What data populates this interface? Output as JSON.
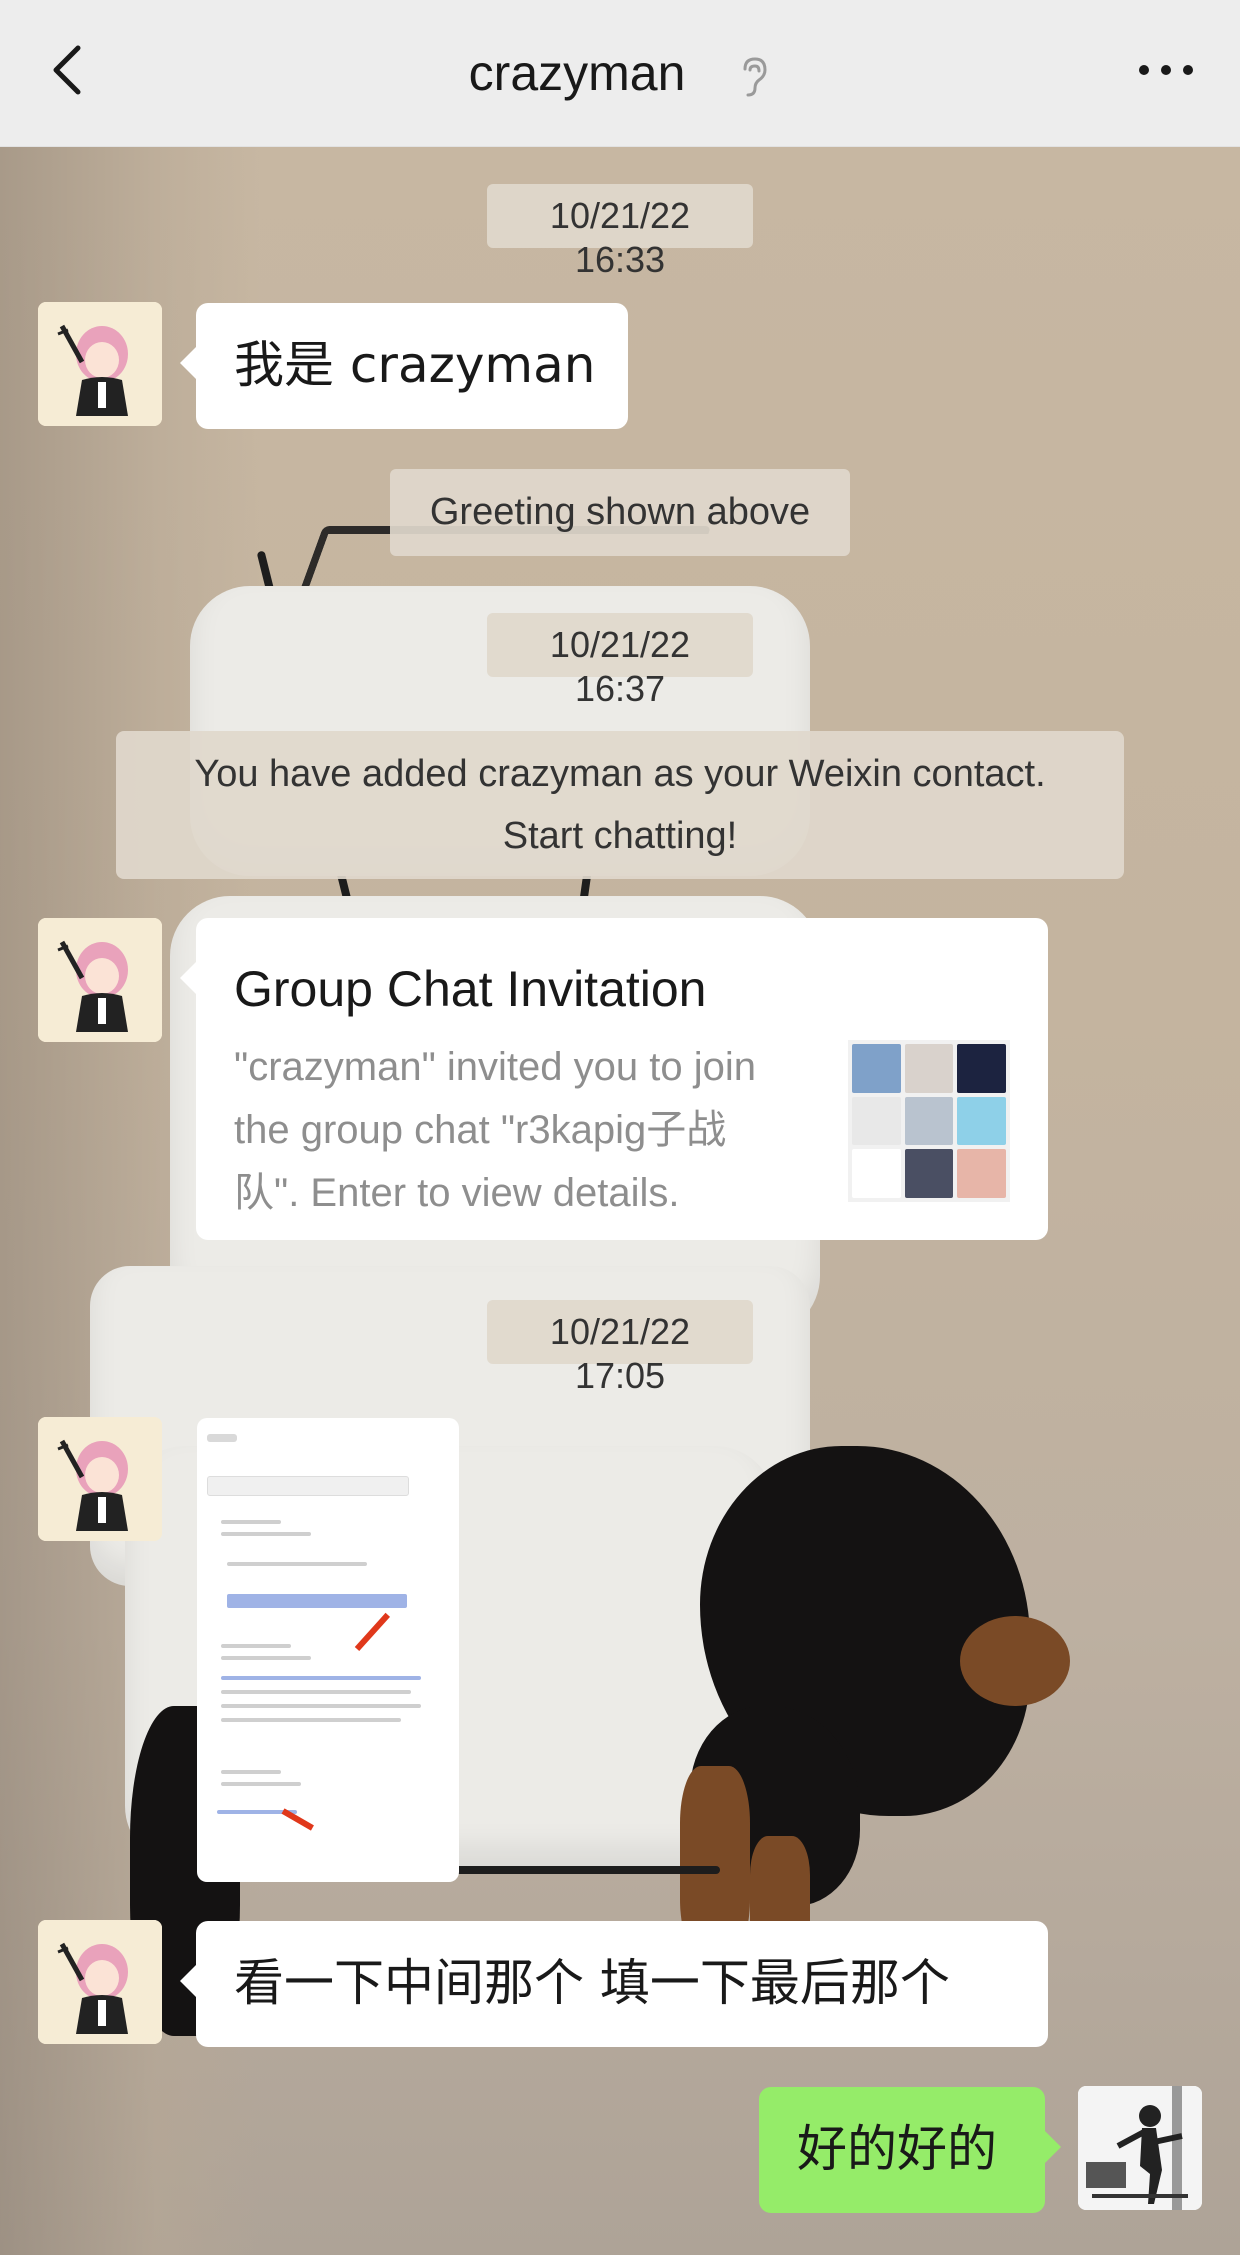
{
  "header": {
    "title": "crazyman",
    "back_icon": "chevron-left-icon",
    "ear_icon": "earpiece-icon",
    "more_icon": "more-dots-icon",
    "background": "#ededed"
  },
  "chat": {
    "timestamps": [
      "10/21/22 16:33",
      "10/21/22 16:37",
      "10/21/22 17:05"
    ],
    "system_notes": {
      "greeting": "Greeting shown above",
      "added_line1": "You have added crazyman as your Weixin contact.",
      "added_line2": "Start chatting!"
    },
    "messages": {
      "m1": "我是 crazyman",
      "card": {
        "title": "Group Chat Invitation",
        "desc_line1": "\"crazyman\" invited you to join",
        "desc_line2": "the group chat \"r3kapig子战",
        "desc_line3": "队\". Enter to view details."
      },
      "m3": "看一下中间那个 填一下最后那个",
      "reply": "好的好的"
    }
  },
  "colors": {
    "my_bubble": "#95ec69",
    "their_bubble": "#ffffff",
    "accent_arrow": "#e0381b"
  }
}
